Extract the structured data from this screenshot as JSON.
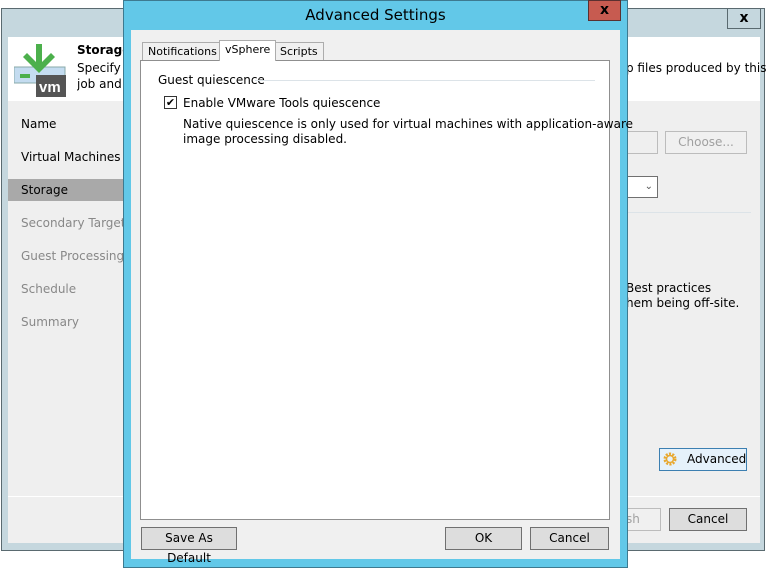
{
  "background_window": {
    "close_label": "x",
    "header": {
      "title": "Storage",
      "description_line1": "Specify p",
      "description_line2": "job and c",
      "description_right": "p files produced by this"
    },
    "nav": [
      "Name",
      "Virtual Machines",
      "Storage",
      "Secondary Target",
      "Guest Processing",
      "Schedule",
      "Summary"
    ],
    "choose_label": "Choose...",
    "note_line1": "Best practices",
    "note_line2": "hem being off-site.",
    "advanced_label": "Advanced",
    "finish_label": "sh",
    "cancel_label": "Cancel"
  },
  "dialog": {
    "title": "Advanced Settings",
    "close_label": "x",
    "tabs": [
      "Notifications",
      "vSphere",
      "Scripts"
    ],
    "group_label": "Guest quiescence",
    "checkbox_label": "Enable VMware Tools quiescence",
    "checkbox_checked": true,
    "note_line1": "Native quiescence is only used for virtual machines with application-aware",
    "note_line2": "image processing disabled.",
    "save_default_label": "Save As Default",
    "ok_label": "OK",
    "cancel_label": "Cancel"
  }
}
